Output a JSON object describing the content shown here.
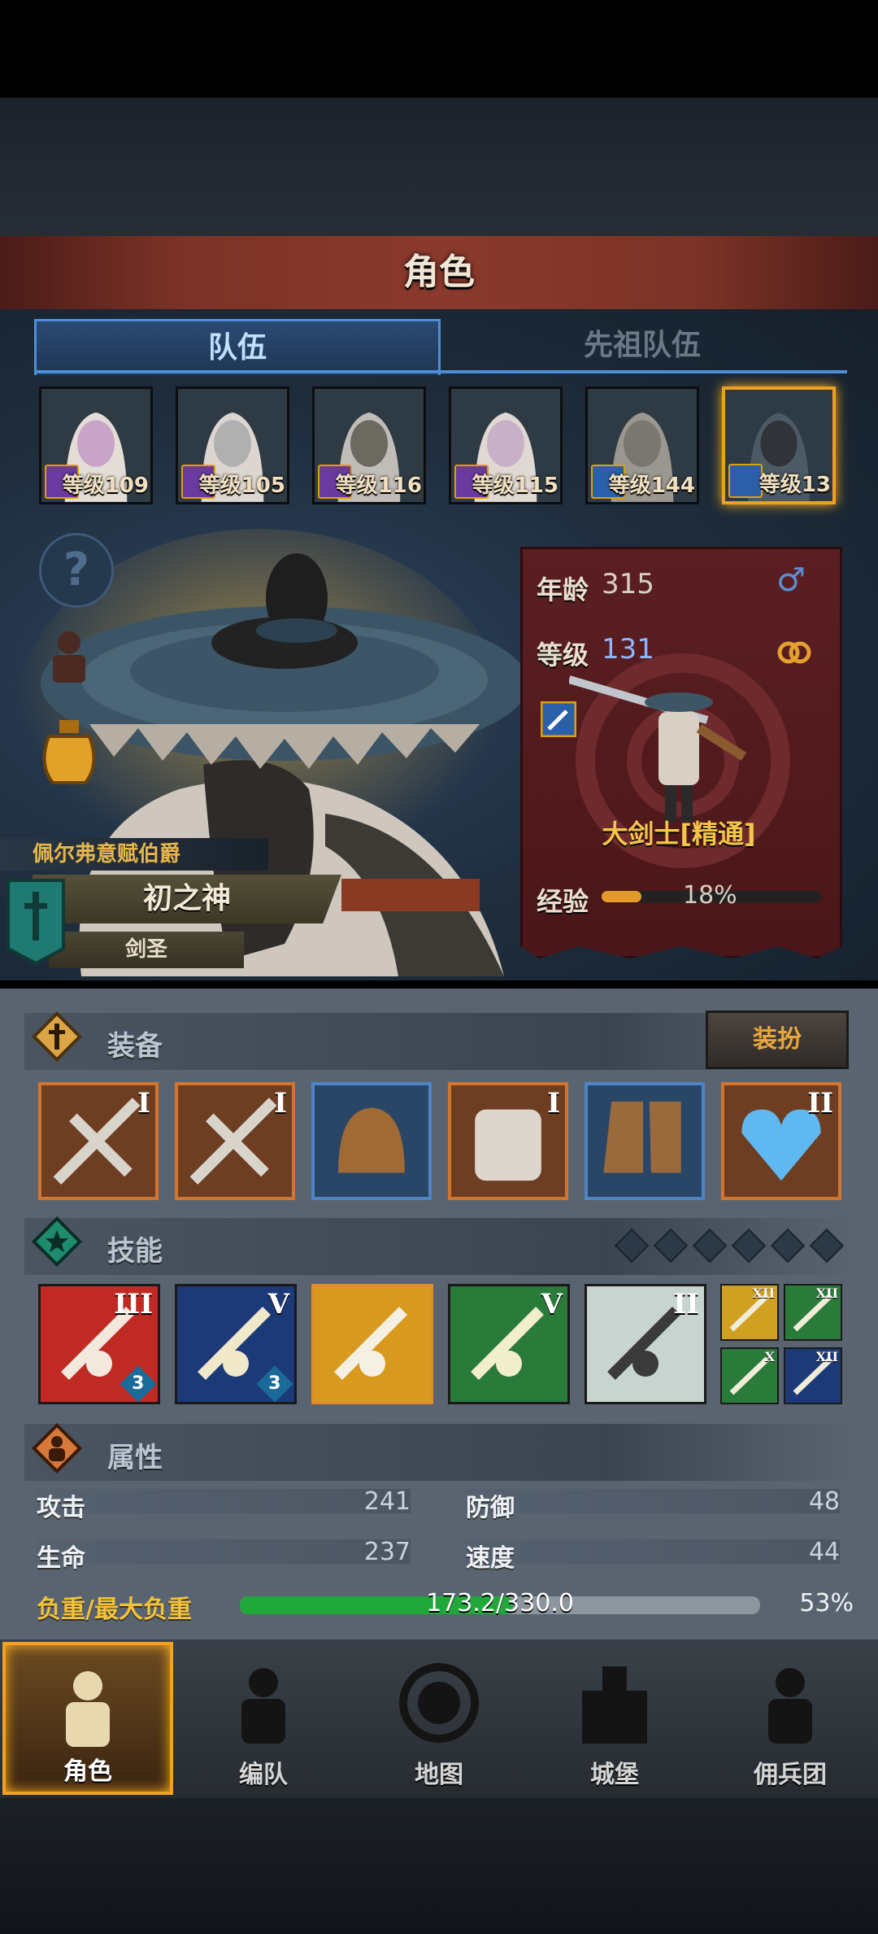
{
  "header": {
    "title": "角色"
  },
  "tabs": [
    {
      "label": "队伍",
      "active": true
    },
    {
      "label": "先祖队伍",
      "active": false
    }
  ],
  "roster": [
    {
      "level": "等级109",
      "class_icon": "staff-icon",
      "color": "purple"
    },
    {
      "level": "等级105",
      "class_icon": "staff-icon",
      "color": "purple"
    },
    {
      "level": "等级116",
      "class_icon": "staff-icon",
      "color": "purple"
    },
    {
      "level": "等级115",
      "class_icon": "staff-icon",
      "color": "purple"
    },
    {
      "level": "等级144",
      "class_icon": "sword-icon",
      "color": "blue"
    },
    {
      "level": "等级13",
      "class_icon": "sword-icon",
      "color": "blue",
      "selected": true
    }
  ],
  "hero": {
    "honor_title": "佩尔弗意赋伯爵",
    "name": "初之神",
    "class_short": "剑圣",
    "age_label": "年龄",
    "age": "315",
    "level_label": "等级",
    "level": "131",
    "class_full": "大剑士[精通]",
    "xp_label": "经验",
    "xp_percent_text": "18%",
    "xp_fraction": 0.18
  },
  "equipment": {
    "label": "装备",
    "dress_button": "装扮",
    "slots": [
      {
        "item": "weapon",
        "tier": "I",
        "rarity": "orange"
      },
      {
        "item": "weapon",
        "tier": "I",
        "rarity": "orange"
      },
      {
        "item": "helmet",
        "tier": "",
        "rarity": "blue"
      },
      {
        "item": "armor",
        "tier": "I",
        "rarity": "orange"
      },
      {
        "item": "boots",
        "tier": "",
        "rarity": "blue"
      },
      {
        "item": "amulet",
        "tier": "II",
        "rarity": "orange"
      }
    ]
  },
  "skills": {
    "label": "技能",
    "tiers": [
      "III",
      "V",
      "",
      "V",
      "II"
    ],
    "badges": [
      "3",
      "3",
      "",
      "",
      ""
    ],
    "mini_tiers": [
      "XII",
      "XII",
      "X",
      "XII"
    ]
  },
  "attributes": {
    "label": "属性",
    "attack_label": "攻击",
    "attack": "241",
    "defense_label": "防御",
    "defense": "48",
    "hp_label": "生命",
    "hp": "237",
    "speed_label": "速度",
    "speed": "44",
    "load_label": "负重/最大负重",
    "load_text": "173.2/330.0",
    "load_percent_text": "53%",
    "load_fraction": 0.525
  },
  "nav": [
    {
      "label": "角色",
      "active": true
    },
    {
      "label": "编队"
    },
    {
      "label": "地图"
    },
    {
      "label": "城堡"
    },
    {
      "label": "佣兵团"
    }
  ],
  "colors": {
    "accent_orange": "#f4a020",
    "tab_blue": "#4c8fd8",
    "xp": "#e39a2a",
    "load": "#21a83a"
  }
}
